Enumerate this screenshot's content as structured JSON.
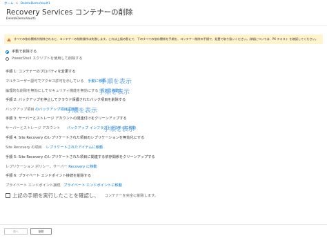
{
  "breadcrumb": {
    "home": "ホーム",
    "vault": "DeleteDemoVault1"
  },
  "page": {
    "title": "Recovery Services コンテナーの削除",
    "more": "...",
    "subtitle": "DeleteDemoVault1"
  },
  "warning": {
    "text": "すべての依存関係が削除されると、コンテナーの削除操作は失敗します。これは上級の影にて、下のすべての依存関係を手順を、コンテナー削除の手順で、処置で取り扱いください。詳細については、PK テキスト を確認してください。"
  },
  "options": [
    {
      "label": "手動で削除する",
      "checked": true
    },
    {
      "label": "PowerShell スクリプトを使用して削除する",
      "checked": false
    }
  ],
  "step1": {
    "heading": "手順 1: コンテナーのプロパティを変更する",
    "soft_delete": "論理的な削除を無効にしてセキュリティ機能を無効にする",
    "soft_delete_link": "設定に移動し",
    "mua_prefix": "マルチユーザー認可でアクセス許可を示している",
    "mua_link": "手動に移動"
  },
  "step2": {
    "heading": "手順 2: バックアップを停止してクラウド保護されたバック項目を削除する",
    "backup_prefix": "バックアップ項目",
    "backup_link": "のバックアップ項目に移動"
  },
  "step3": {
    "heading": "手順 3: サーバーとストレージ アカウントの関連付けをクリーンアップする",
    "server_prefix": "サーバーとストレージ アカウント",
    "server_link": "バックアップ インフラストラクチャに移動"
  },
  "step4": {
    "heading": "手順 4: Site Recovery のレプリケートされた項目のレプリケーションを無効化にする",
    "sr_prefix": "Site Recovery の項目",
    "sr_link": "レプリケートされたアイテムに移動"
  },
  "step5": {
    "heading": "手順 5: Site Recovery のレプリケートされた項目に関連する依存関係をクリーンアップする",
    "policy_prefix": "レプリケーション ポリシー、サーバー",
    "policy_link": "Recovery に移動"
  },
  "step6": {
    "heading": "手順 6: プライベート エンドポイント接続を削除する",
    "pe_prefix": "プライベート エンドポイント接続",
    "pe_link": "プライベート エンドポイントに移動"
  },
  "confirm": {
    "label": "上記の手順を実行したことを確認し、",
    "suffix": "コンテナーを完全に削除します。"
  },
  "overlays": {
    "steps_label": "手順を表示"
  },
  "buttons": {
    "prev": "前へ",
    "delete": "削除"
  }
}
